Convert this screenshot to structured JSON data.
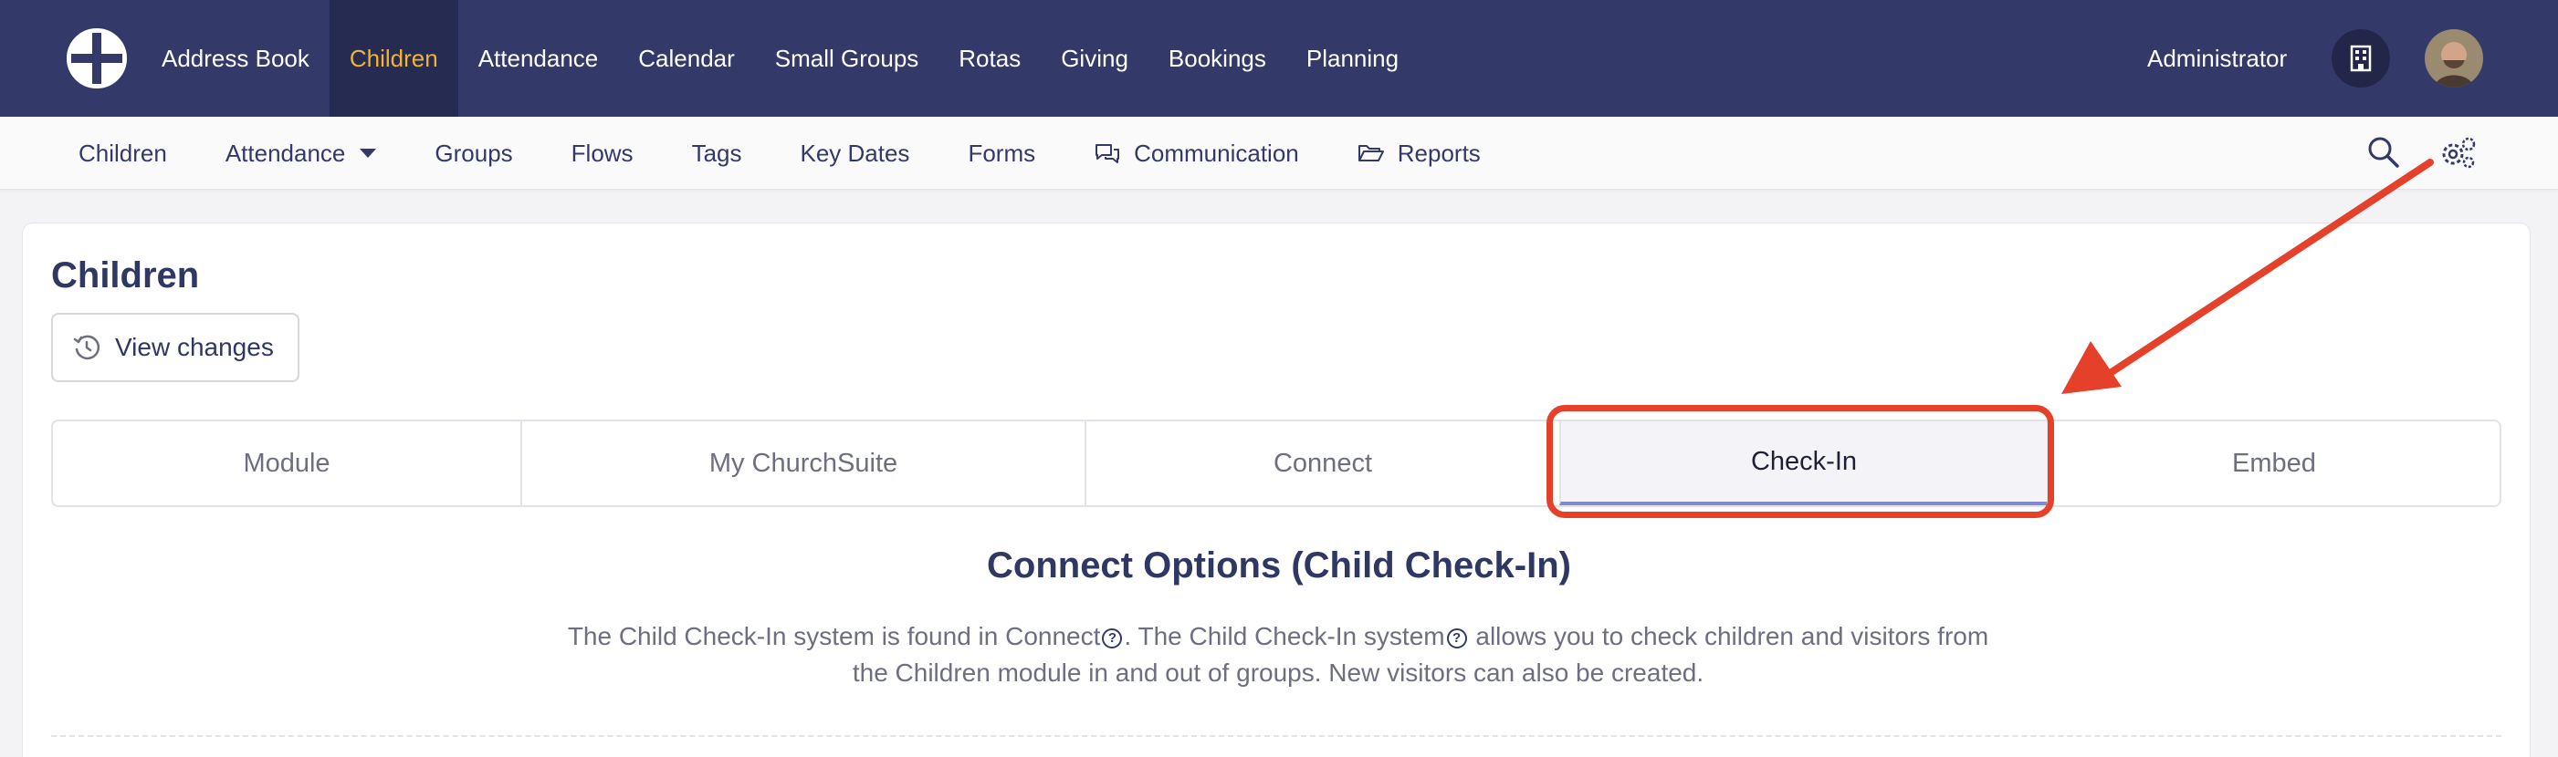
{
  "topnav": {
    "items": [
      {
        "label": "Address Book"
      },
      {
        "label": "Children",
        "active": true
      },
      {
        "label": "Attendance"
      },
      {
        "label": "Calendar"
      },
      {
        "label": "Small Groups"
      },
      {
        "label": "Rotas"
      },
      {
        "label": "Giving"
      },
      {
        "label": "Bookings"
      },
      {
        "label": "Planning"
      }
    ],
    "user_role": "Administrator",
    "icons": {
      "logo": "churchsuite-logo",
      "building": "building-icon",
      "avatar": "avatar"
    }
  },
  "subnav": {
    "items": [
      {
        "label": "Children"
      },
      {
        "label": "Attendance"
      },
      {
        "label": "Groups"
      },
      {
        "label": "Flows"
      },
      {
        "label": "Tags"
      },
      {
        "label": "Key Dates"
      },
      {
        "label": "Forms"
      },
      {
        "label": "Communication"
      },
      {
        "label": "Reports"
      }
    ],
    "icons": {
      "search": "search-icon",
      "settings": "gear-icon"
    }
  },
  "page": {
    "title": "Children",
    "view_changes": "View changes",
    "tabs": [
      {
        "label": "Module"
      },
      {
        "label": "My ChurchSuite"
      },
      {
        "label": "Connect"
      },
      {
        "label": "Check-In",
        "active": true
      },
      {
        "label": "Embed"
      }
    ],
    "section_title": "Connect Options (Child Check-In)",
    "desc": {
      "part1": "The Child Check-In system is found in Connect",
      "part2": ". The Child Check-In system",
      "part3": " allows you to check children and visitors from the Children module in and out of groups. New visitors can also be created."
    }
  },
  "colors": {
    "topbar": "#333a6a",
    "active_nav": "#f2b233",
    "annotation": "#e5402a"
  }
}
